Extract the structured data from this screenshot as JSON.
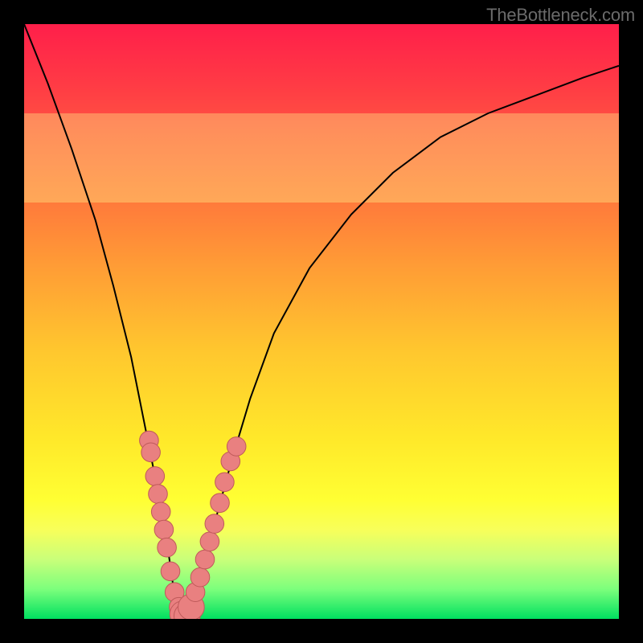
{
  "watermark_text": "TheBottleneck.com",
  "colors": {
    "frame": "#000000",
    "curve": "#000000",
    "marker_fill": "#e98080",
    "marker_stroke": "#bf5a5a",
    "gradient_top": "#ff1f4a",
    "gradient_bottom": "#00e060"
  },
  "chart_data": {
    "type": "line",
    "title": "",
    "xlabel": "",
    "ylabel": "",
    "xlim": [
      0,
      100
    ],
    "ylim": [
      0,
      100
    ],
    "grid": false,
    "legend": false,
    "acceptable_band_pct": [
      70,
      85
    ],
    "series": [
      {
        "name": "bottleneck-curve",
        "x": [
          0,
          4,
          8,
          12,
          15,
          18,
          20,
          22,
          24,
          25,
          26,
          27,
          28,
          30,
          32,
          35,
          38,
          42,
          48,
          55,
          62,
          70,
          78,
          86,
          94,
          100
        ],
        "y": [
          100,
          90,
          79,
          67,
          56,
          44,
          34,
          24,
          13,
          6,
          2,
          0,
          2,
          8,
          16,
          27,
          37,
          48,
          59,
          68,
          75,
          81,
          85,
          88,
          91,
          93
        ]
      }
    ],
    "markers": [
      {
        "x": 21.0,
        "y": 30.0,
        "r": 1.6
      },
      {
        "x": 21.3,
        "y": 28.0,
        "r": 1.6
      },
      {
        "x": 22.0,
        "y": 24.0,
        "r": 1.6
      },
      {
        "x": 22.5,
        "y": 21.0,
        "r": 1.6
      },
      {
        "x": 23.0,
        "y": 18.0,
        "r": 1.6
      },
      {
        "x": 23.5,
        "y": 15.0,
        "r": 1.6
      },
      {
        "x": 24.0,
        "y": 12.0,
        "r": 1.6
      },
      {
        "x": 24.6,
        "y": 8.0,
        "r": 1.6
      },
      {
        "x": 25.3,
        "y": 4.5,
        "r": 1.6
      },
      {
        "x": 26.0,
        "y": 2.0,
        "r": 1.6
      },
      {
        "x": 26.7,
        "y": 0.8,
        "r": 2.2
      },
      {
        "x": 27.4,
        "y": 0.5,
        "r": 2.2
      },
      {
        "x": 28.1,
        "y": 2.0,
        "r": 2.2
      },
      {
        "x": 28.8,
        "y": 4.5,
        "r": 1.6
      },
      {
        "x": 29.6,
        "y": 7.0,
        "r": 1.6
      },
      {
        "x": 30.4,
        "y": 10.0,
        "r": 1.6
      },
      {
        "x": 31.2,
        "y": 13.0,
        "r": 1.6
      },
      {
        "x": 32.0,
        "y": 16.0,
        "r": 1.6
      },
      {
        "x": 32.9,
        "y": 19.5,
        "r": 1.6
      },
      {
        "x": 33.7,
        "y": 23.0,
        "r": 1.6
      },
      {
        "x": 34.7,
        "y": 26.5,
        "r": 1.6
      },
      {
        "x": 35.7,
        "y": 29.0,
        "r": 1.6
      }
    ]
  }
}
